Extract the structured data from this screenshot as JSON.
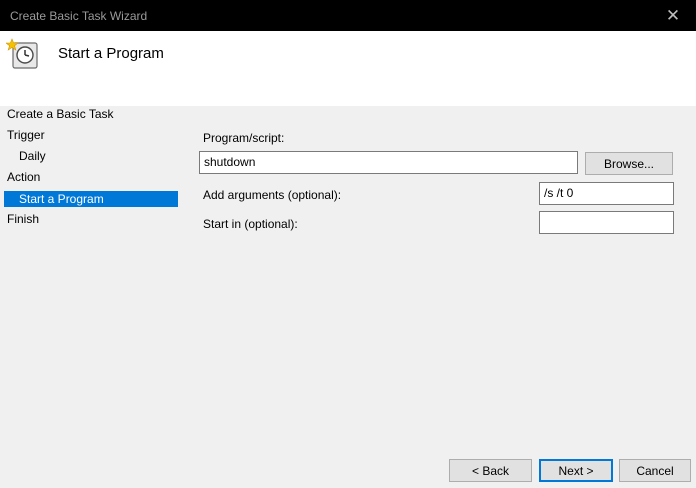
{
  "window": {
    "title": "Create Basic Task Wizard",
    "close_glyph": "✕"
  },
  "header": {
    "icon": "task-scheduler-clock-icon",
    "title": "Start a Program"
  },
  "nav": {
    "items": [
      {
        "label": "Create a Basic Task"
      },
      {
        "label": "Trigger"
      },
      {
        "label": "Daily"
      },
      {
        "label": "Action"
      },
      {
        "label": "Start a Program"
      },
      {
        "label": "Finish"
      }
    ]
  },
  "form": {
    "program_label": "Program/script:",
    "program_value": "shutdown",
    "browse_label": "Browse...",
    "args_label": "Add arguments (optional):",
    "args_value": "/s /t 0",
    "startin_label": "Start in (optional):",
    "startin_value": ""
  },
  "buttons": {
    "back": "< Back",
    "next": "Next >",
    "cancel": "Cancel"
  },
  "colors": {
    "accent": "#0078d7",
    "titlebar": "#000000",
    "dialog_bg": "#f0f0f0"
  }
}
